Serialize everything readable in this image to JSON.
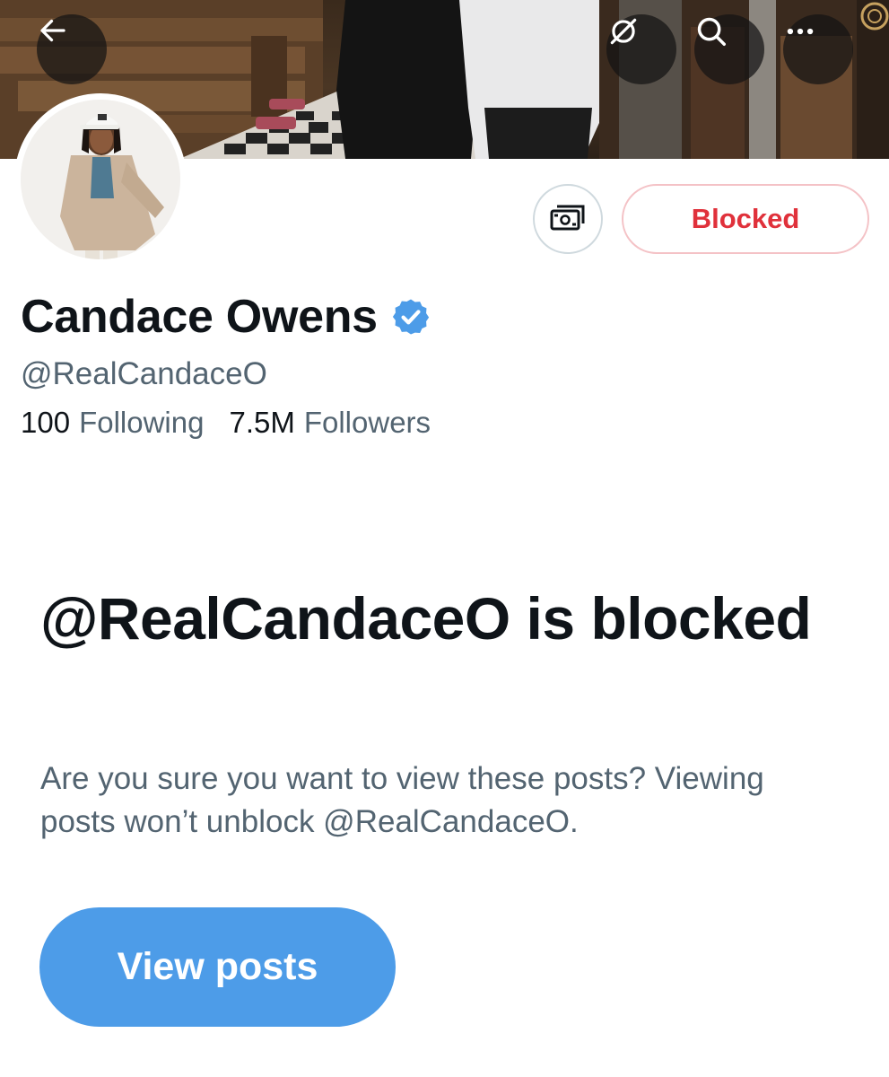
{
  "header": {
    "back_icon": "arrow-left-icon",
    "translate_icon": "translate-slash-icon",
    "search_icon": "search-icon",
    "more_icon": "more-horizontal-icon"
  },
  "profile": {
    "display_name": "Candace Owens",
    "verified": true,
    "handle": "@RealCandaceO",
    "following_count": "100",
    "following_label": "Following",
    "followers_count": "7.5M",
    "followers_label": "Followers"
  },
  "actions": {
    "tip_icon": "money-icon",
    "blocked_label": "Blocked"
  },
  "notice": {
    "title": "@RealCandaceO is blocked",
    "description": "Are you sure you want to view these posts? Viewing posts won’t unblock @RealCandaceO.",
    "view_posts_label": "View posts"
  },
  "colors": {
    "verified_blue": "#4d9ce8",
    "blocked_red": "#e0313b",
    "button_blue": "#4d9ce8",
    "secondary_text": "#536471",
    "primary_text": "#0f1419"
  }
}
